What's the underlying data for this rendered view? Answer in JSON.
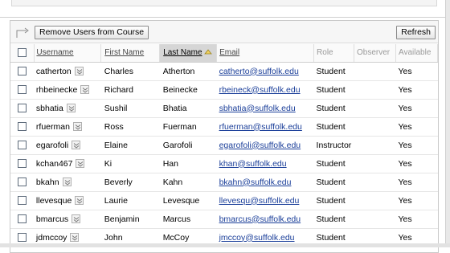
{
  "toolbar": {
    "remove_label": "Remove Users from Course",
    "refresh_label": "Refresh"
  },
  "columns": {
    "username": "Username",
    "first_name": "First Name",
    "last_name": "Last Name",
    "email": "Email",
    "role": "Role",
    "observer": "Observer",
    "available": "Available"
  },
  "sort": {
    "column": "last_name",
    "direction": "ascending"
  },
  "rows": [
    {
      "username": "catherton",
      "first": "Charles",
      "last": "Atherton",
      "email": "catherto@suffolk.edu",
      "role": "Student",
      "observer": "",
      "available": "Yes"
    },
    {
      "username": "rhbeinecke",
      "first": "Richard",
      "last": "Beinecke",
      "email": "rbeineck@suffolk.edu",
      "role": "Student",
      "observer": "",
      "available": "Yes"
    },
    {
      "username": "sbhatia",
      "first": "Sushil",
      "last": "Bhatia",
      "email": "sbhatia@suffolk.edu",
      "role": "Student",
      "observer": "",
      "available": "Yes"
    },
    {
      "username": "rfuerman",
      "first": "Ross",
      "last": "Fuerman",
      "email": "rfuerman@suffolk.edu",
      "role": "Student",
      "observer": "",
      "available": "Yes"
    },
    {
      "username": "egarofoli",
      "first": "Elaine",
      "last": "Garofoli",
      "email": "egarofoli@suffolk.edu",
      "role": "Instructor",
      "observer": "",
      "available": "Yes"
    },
    {
      "username": "kchan467",
      "first": "Ki",
      "last": "Han",
      "email": "khan@suffolk.edu",
      "role": "Student",
      "observer": "",
      "available": "Yes"
    },
    {
      "username": "bkahn",
      "first": "Beverly",
      "last": "Kahn",
      "email": "bkahn@suffolk.edu",
      "role": "Student",
      "observer": "",
      "available": "Yes"
    },
    {
      "username": "llevesque",
      "first": "Laurie",
      "last": "Levesque",
      "email": "llevesqu@suffolk.edu",
      "role": "Student",
      "observer": "",
      "available": "Yes"
    },
    {
      "username": "bmarcus",
      "first": "Benjamin",
      "last": "Marcus",
      "email": "bmarcus@suffolk.edu",
      "role": "Student",
      "observer": "",
      "available": "Yes"
    },
    {
      "username": "jdmccoy",
      "first": "John",
      "last": "McCoy",
      "email": "jmccoy@suffolk.edu",
      "role": "Student",
      "observer": "",
      "available": "Yes"
    }
  ],
  "colors": {
    "link": "#1a3e99",
    "sorted_header_bg": "#d6d6d6"
  }
}
